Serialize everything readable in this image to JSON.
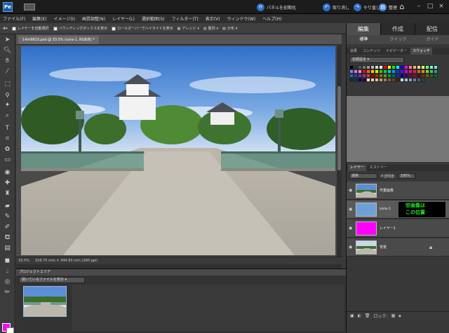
{
  "titlebar": {
    "app_icon": "Pe",
    "reset_panels": "パネルを初期化",
    "undo": "取り消し",
    "redo": "やり直し",
    "organize": "整理"
  },
  "menu": [
    "ファイル(F)",
    "編集(E)",
    "イメージ(I)",
    "画質調整(N)",
    "レイヤー(L)",
    "選択範囲(S)",
    "フィルター(T)",
    "表示(V)",
    "ウィンドウ(W)",
    "ヘルプ(H)"
  ],
  "options": {
    "auto_select": "レイヤーを自動選択",
    "show_bbox": "バウンディングボックスを表示",
    "show_rollover": "ロールオーバーでハイライトを表示",
    "arrange": "アレンジ",
    "align": "整列",
    "distribute": "分布"
  },
  "document": {
    "tab_title": "14m9810.psd @ 33.5% (sora-1, RGB/8) *",
    "zoom": "33.5%",
    "dimensions": "316.75 mm × 344.93 mm (300 ppi)"
  },
  "project_bin": {
    "title": "プロジェクトエリア",
    "filter": "開いているファイルを表示"
  },
  "right_panel": {
    "tabs": [
      "編集",
      "作成",
      "配信"
    ],
    "subtabs": [
      "標準",
      "クイック",
      "ガイド"
    ],
    "swatch_tabs": [
      "効果",
      "コンテンツ",
      "ナビゲーター",
      "スウォッチ"
    ],
    "swatch_set": "初期設定"
  },
  "swatch_colors": [
    "#000000",
    "#333333",
    "#555555",
    "#777777",
    "#999999",
    "#bbbbbb",
    "#dddddd",
    "#ffffff",
    "#ff0000",
    "#ffff00",
    "#00ff00",
    "#00ffff",
    "#0000ff",
    "#ff00ff",
    "#ff8080",
    "#ffb080",
    "#ffe080",
    "#e0ff80",
    "#80ff80",
    "#80ffe0",
    "#80e0ff",
    "#8080ff",
    "#c080ff",
    "#ff80e0",
    "#ff0000",
    "#ff6600",
    "#ffcc00",
    "#ccff00",
    "#33cc00",
    "#00cc66",
    "#00cccc",
    "#0099ff",
    "#0033ff",
    "#6600ff",
    "#cc00ff",
    "#ff0099",
    "#cc3333",
    "#cc6633",
    "#cc9933",
    "#99cc33",
    "#33cc66",
    "#339999",
    "#336699",
    "#3333cc",
    "#663399",
    "#993399",
    "#cc3366",
    "#990000",
    "#993300",
    "#996600",
    "#669900",
    "#009933",
    "#006666",
    "#003399",
    "#000099",
    "#330066",
    "#660066",
    "#990033",
    "#660000",
    "#663300",
    "#666600",
    "#336600",
    "#006633",
    "#003333",
    "#003366",
    "#000066",
    "#330033",
    "#ffe0c0",
    "#ffd0a0",
    "#e0c090",
    "#c0a070",
    "#a08050",
    "#806040",
    "#604020",
    "#402010",
    "#c0e0ff",
    "#a0c0e0",
    "#80a0c0",
    "#6080a0",
    "#406080",
    "#204060"
  ],
  "layers_panel": {
    "tabs": [
      "レイヤー",
      "ヒストリー"
    ],
    "blend_mode": "通常",
    "opacity_label": "不透明度:",
    "opacity_value": "100%",
    "note": "空画像は\nこの位置",
    "lock_label": "ロック:",
    "layers": [
      {
        "name": "作業画像",
        "thumb_color": "#dfe6ee"
      },
      {
        "name": "sora-1",
        "thumb_color": "#6f9fd8"
      },
      {
        "name": "レイヤー1",
        "thumb_color": "#ff00ff"
      },
      {
        "name": "背景",
        "thumb_color": "#cfd6dd"
      }
    ]
  }
}
